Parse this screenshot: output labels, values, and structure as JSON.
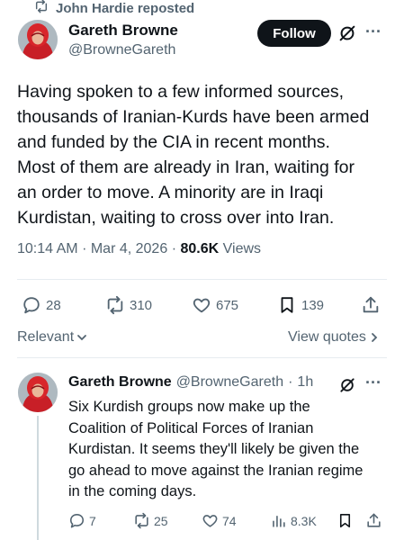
{
  "repost": {
    "label": "John Hardie reposted",
    "icon": "repost-icon"
  },
  "tweet": {
    "author_name": "Gareth Browne",
    "author_handle": "@BrowneGareth",
    "follow_label": "Follow",
    "lines": [
      "Having spoken to a few informed sources,",
      "thousands of Iranian-Kurds have been armed",
      "and funded by the CIA in recent months.",
      "Most of them are already in Iran, waiting for",
      "an order to move. A minority are in Iraqi",
      "Kurdistan, waiting to cross over into Iran."
    ],
    "time": "10:14 AM",
    "date": "Mar 4, 2026",
    "views_count": "80.6K",
    "views_label": "Views",
    "stats": {
      "replies": "28",
      "reposts": "310",
      "likes": "675",
      "bookmarks": "139"
    }
  },
  "sort": {
    "relevant_label": "Relevant",
    "view_quotes_label": "View quotes"
  },
  "reply": {
    "author_name": "Gareth Browne",
    "author_handle": "@BrowneGareth",
    "separator": "·",
    "time_ago": "1h",
    "lines": [
      "Six Kurdish groups now make up the",
      "Coalition of Political Forces of Iranian",
      "Kurdistan. It seems they'll likely be given the",
      "go ahead to move against the Iranian regime",
      "in the coming days."
    ],
    "stats": {
      "replies": "7",
      "reposts": "25",
      "likes": "74",
      "views": "8.3K"
    }
  },
  "colors": {
    "text": "#0f1419",
    "secondary": "#536471",
    "button_bg": "#0f1419",
    "avatar_hood": "#d8262b"
  }
}
